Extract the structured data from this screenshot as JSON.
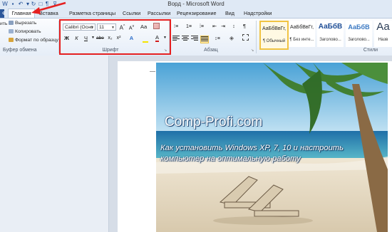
{
  "window": {
    "title": "Ворд - Microsoft Word"
  },
  "quick_access": {
    "icons": [
      "word-app-icon",
      "save-icon",
      "undo-icon",
      "repeat-icon",
      "new-doc-icon",
      "paragraph-marks-icon",
      "customize-icon"
    ]
  },
  "tabs": [
    {
      "label": "Файл"
    },
    {
      "label": "Главная"
    },
    {
      "label": "Вставка"
    },
    {
      "label": "Разметка страницы"
    },
    {
      "label": "Ссылки"
    },
    {
      "label": "Рассылки"
    },
    {
      "label": "Рецензирование"
    },
    {
      "label": "Вид"
    },
    {
      "label": "Надстройки"
    }
  ],
  "clipboard": {
    "paste_label": "ить",
    "cut": "Вырезать",
    "copy": "Копировать",
    "format_painter": "Формат по образцу",
    "group_label": "Буфер обмена"
  },
  "font": {
    "font_name": "Calibri (Осно",
    "font_size": "11",
    "grow": "A",
    "shrink": "A",
    "change_case": "Aa",
    "bold": "Ж",
    "italic": "К",
    "underline": "Ч",
    "strike": "abe",
    "subscript": "x₂",
    "superscript": "x²",
    "text_effects": "A",
    "font_color": "A",
    "group_label": "Шрифт"
  },
  "paragraph": {
    "group_label": "Абзац",
    "pilcrow": "¶"
  },
  "styles": {
    "items": [
      {
        "sample": "АаБбВвГг,",
        "name": "¶ Обычный"
      },
      {
        "sample": "АаБбВвГг,",
        "name": "¶ Без инте..."
      },
      {
        "sample": "АаБбВ",
        "name": "Заголово..."
      },
      {
        "sample": "АаБбВ",
        "name": "Заголово..."
      },
      {
        "sample": "Аа",
        "name": "Назв"
      }
    ],
    "group_label": "Стили"
  },
  "document": {
    "watermark": "Comp-Profi.com",
    "caption": "Как установить Windows XP, 7, 10 и настроить компьютер на оптимальную работу"
  },
  "colors": {
    "ribbon_accent": "#2b579a",
    "annotation_red": "#e52020",
    "sky_top": "#6fb6dd",
    "sea": "#2f87b8",
    "sand": "#e8ddc6"
  }
}
